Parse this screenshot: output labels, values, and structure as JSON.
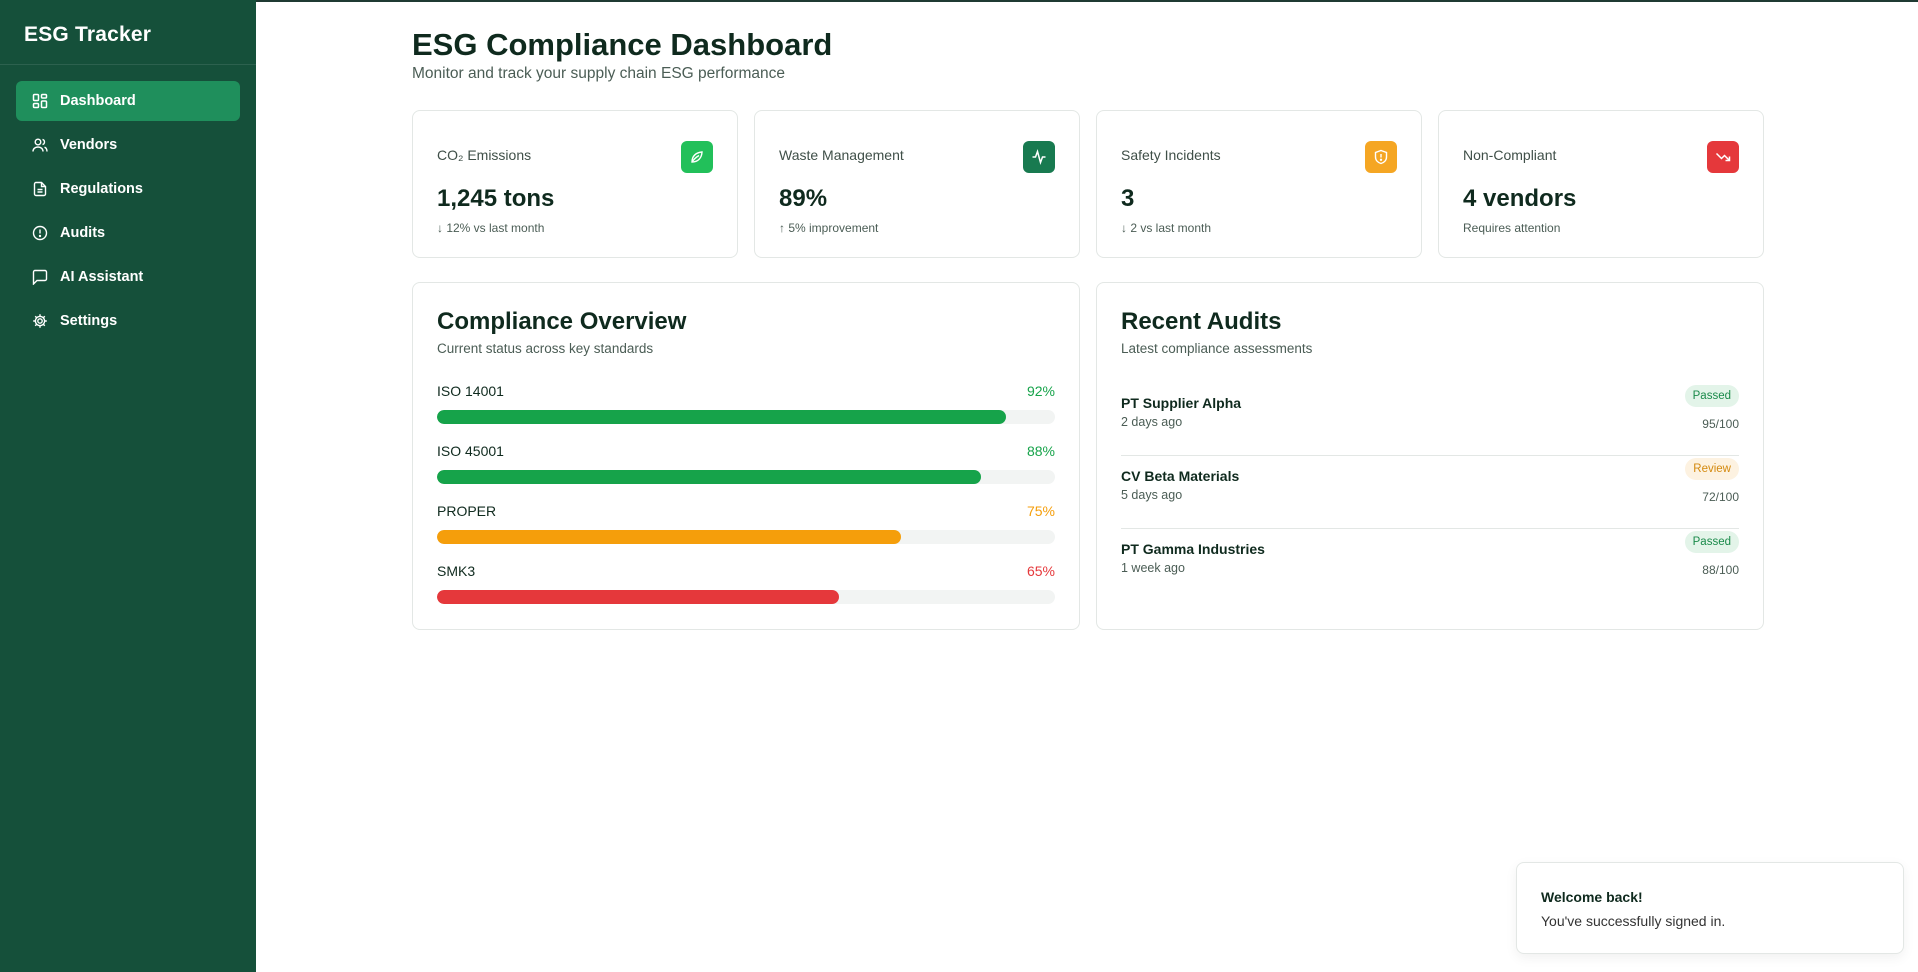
{
  "app": {
    "title": "ESG Tracker"
  },
  "sidebar": {
    "items": [
      {
        "label": "Dashboard",
        "icon": "dashboard-grid-icon",
        "active": true
      },
      {
        "label": "Vendors",
        "icon": "users-icon",
        "active": false
      },
      {
        "label": "Regulations",
        "icon": "file-text-icon",
        "active": false
      },
      {
        "label": "Audits",
        "icon": "alert-circle-icon",
        "active": false
      },
      {
        "label": "AI Assistant",
        "icon": "message-square-icon",
        "active": false
      },
      {
        "label": "Settings",
        "icon": "gear-icon",
        "active": false
      }
    ]
  },
  "header": {
    "title": "ESG Compliance Dashboard",
    "subtitle": "Monitor and track your supply chain ESG performance"
  },
  "stats": [
    {
      "label": "CO₂ Emissions",
      "value": "1,245 tons",
      "note": "↓ 12% vs last month",
      "icon": "leaf-icon",
      "color": "#22c05a"
    },
    {
      "label": "Waste Management",
      "value": "89%",
      "note": "↑ 5% improvement",
      "icon": "activity-icon",
      "color": "#187a50"
    },
    {
      "label": "Safety Incidents",
      "value": "3",
      "note": "↓ 2 vs last month",
      "icon": "shield-alert-icon",
      "color": "#f5a623"
    },
    {
      "label": "Non-Compliant",
      "value": "4 vendors",
      "note": "Requires attention",
      "icon": "trending-down-icon",
      "color": "#e5383b"
    }
  ],
  "compliance": {
    "title": "Compliance Overview",
    "subtitle": "Current status across key standards",
    "items": [
      {
        "name": "ISO 14001",
        "pct_label": "92%",
        "value": 0.92,
        "color": "#16a34a"
      },
      {
        "name": "ISO 45001",
        "pct_label": "88%",
        "value": 0.88,
        "color": "#16a34a"
      },
      {
        "name": "PROPER",
        "pct_label": "75%",
        "value": 0.75,
        "color": "#f59e0b"
      },
      {
        "name": "SMK3",
        "pct_label": "65%",
        "value": 0.65,
        "color": "#e5383b"
      }
    ]
  },
  "audits": {
    "title": "Recent Audits",
    "subtitle": "Latest compliance assessments",
    "items": [
      {
        "name": "PT Supplier Alpha",
        "time": "2 days ago",
        "status": "Passed",
        "status_type": "passed",
        "score": "95/100"
      },
      {
        "name": "CV Beta Materials",
        "time": "5 days ago",
        "status": "Review",
        "status_type": "review",
        "score": "72/100"
      },
      {
        "name": "PT Gamma Industries",
        "time": "1 week ago",
        "status": "Passed",
        "status_type": "passed",
        "score": "88/100"
      }
    ]
  },
  "toast": {
    "title": "Welcome back!",
    "message": "You've successfully signed in."
  }
}
